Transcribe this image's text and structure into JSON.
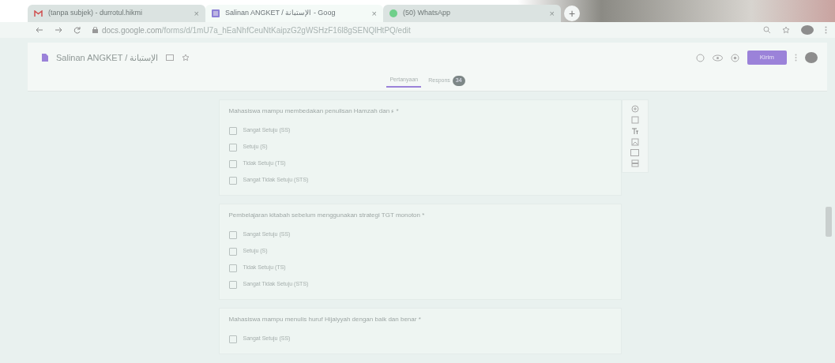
{
  "browser": {
    "tabs": [
      {
        "title": "(tanpa subjek) - durrotul.hikmi",
        "close": "×",
        "selected": false
      },
      {
        "title": "Salinan ANGKET / الإستبانة - Goog",
        "close": "×",
        "selected": true
      },
      {
        "title": "(50) WhatsApp",
        "close": "×",
        "selected": false
      }
    ],
    "new_tab": "+",
    "url": "docs.google.com/forms/d/1mU7a_hEaNhfCeuNtKaipzG2gWSHzF16l8gSENQlHtPQ/edit"
  },
  "form_header": {
    "title": "Salinan ANGKET / الإستبانة",
    "send_button": "Kirim",
    "tabs": [
      {
        "label": "Pertanyaan",
        "selected": true
      },
      {
        "label": "Respons",
        "selected": false,
        "badge": "34"
      }
    ]
  },
  "questions": [
    {
      "title": "Mahasiswa mampu membedakan penulisan Hamzah dan ء *",
      "options": [
        {
          "label": "Sangat Setuju (SS)",
          "checked": false
        },
        {
          "label": "Setuju (S)",
          "checked": false
        },
        {
          "label": "Tidak Setuju (TS)",
          "checked": false
        },
        {
          "label": "Sangat Tidak Setuju (STS)",
          "checked": false
        }
      ]
    },
    {
      "title": "Pembelajaran kitabah sebelum menggunakan strategi TGT monoton *",
      "options": [
        {
          "label": "Sangat Setuju (SS)",
          "checked": false
        },
        {
          "label": "Setuju (S)",
          "checked": false
        },
        {
          "label": "Tidak Setuju (TS)",
          "checked": false
        },
        {
          "label": "Sangat Tidak Setuju (STS)",
          "checked": false
        }
      ]
    },
    {
      "title": "Mahasiswa mampu menulis huruf Hijaiyyah dengan baik dan benar *",
      "options": [
        {
          "label": "Sangat Setuju (SS)",
          "checked": false
        }
      ]
    }
  ]
}
